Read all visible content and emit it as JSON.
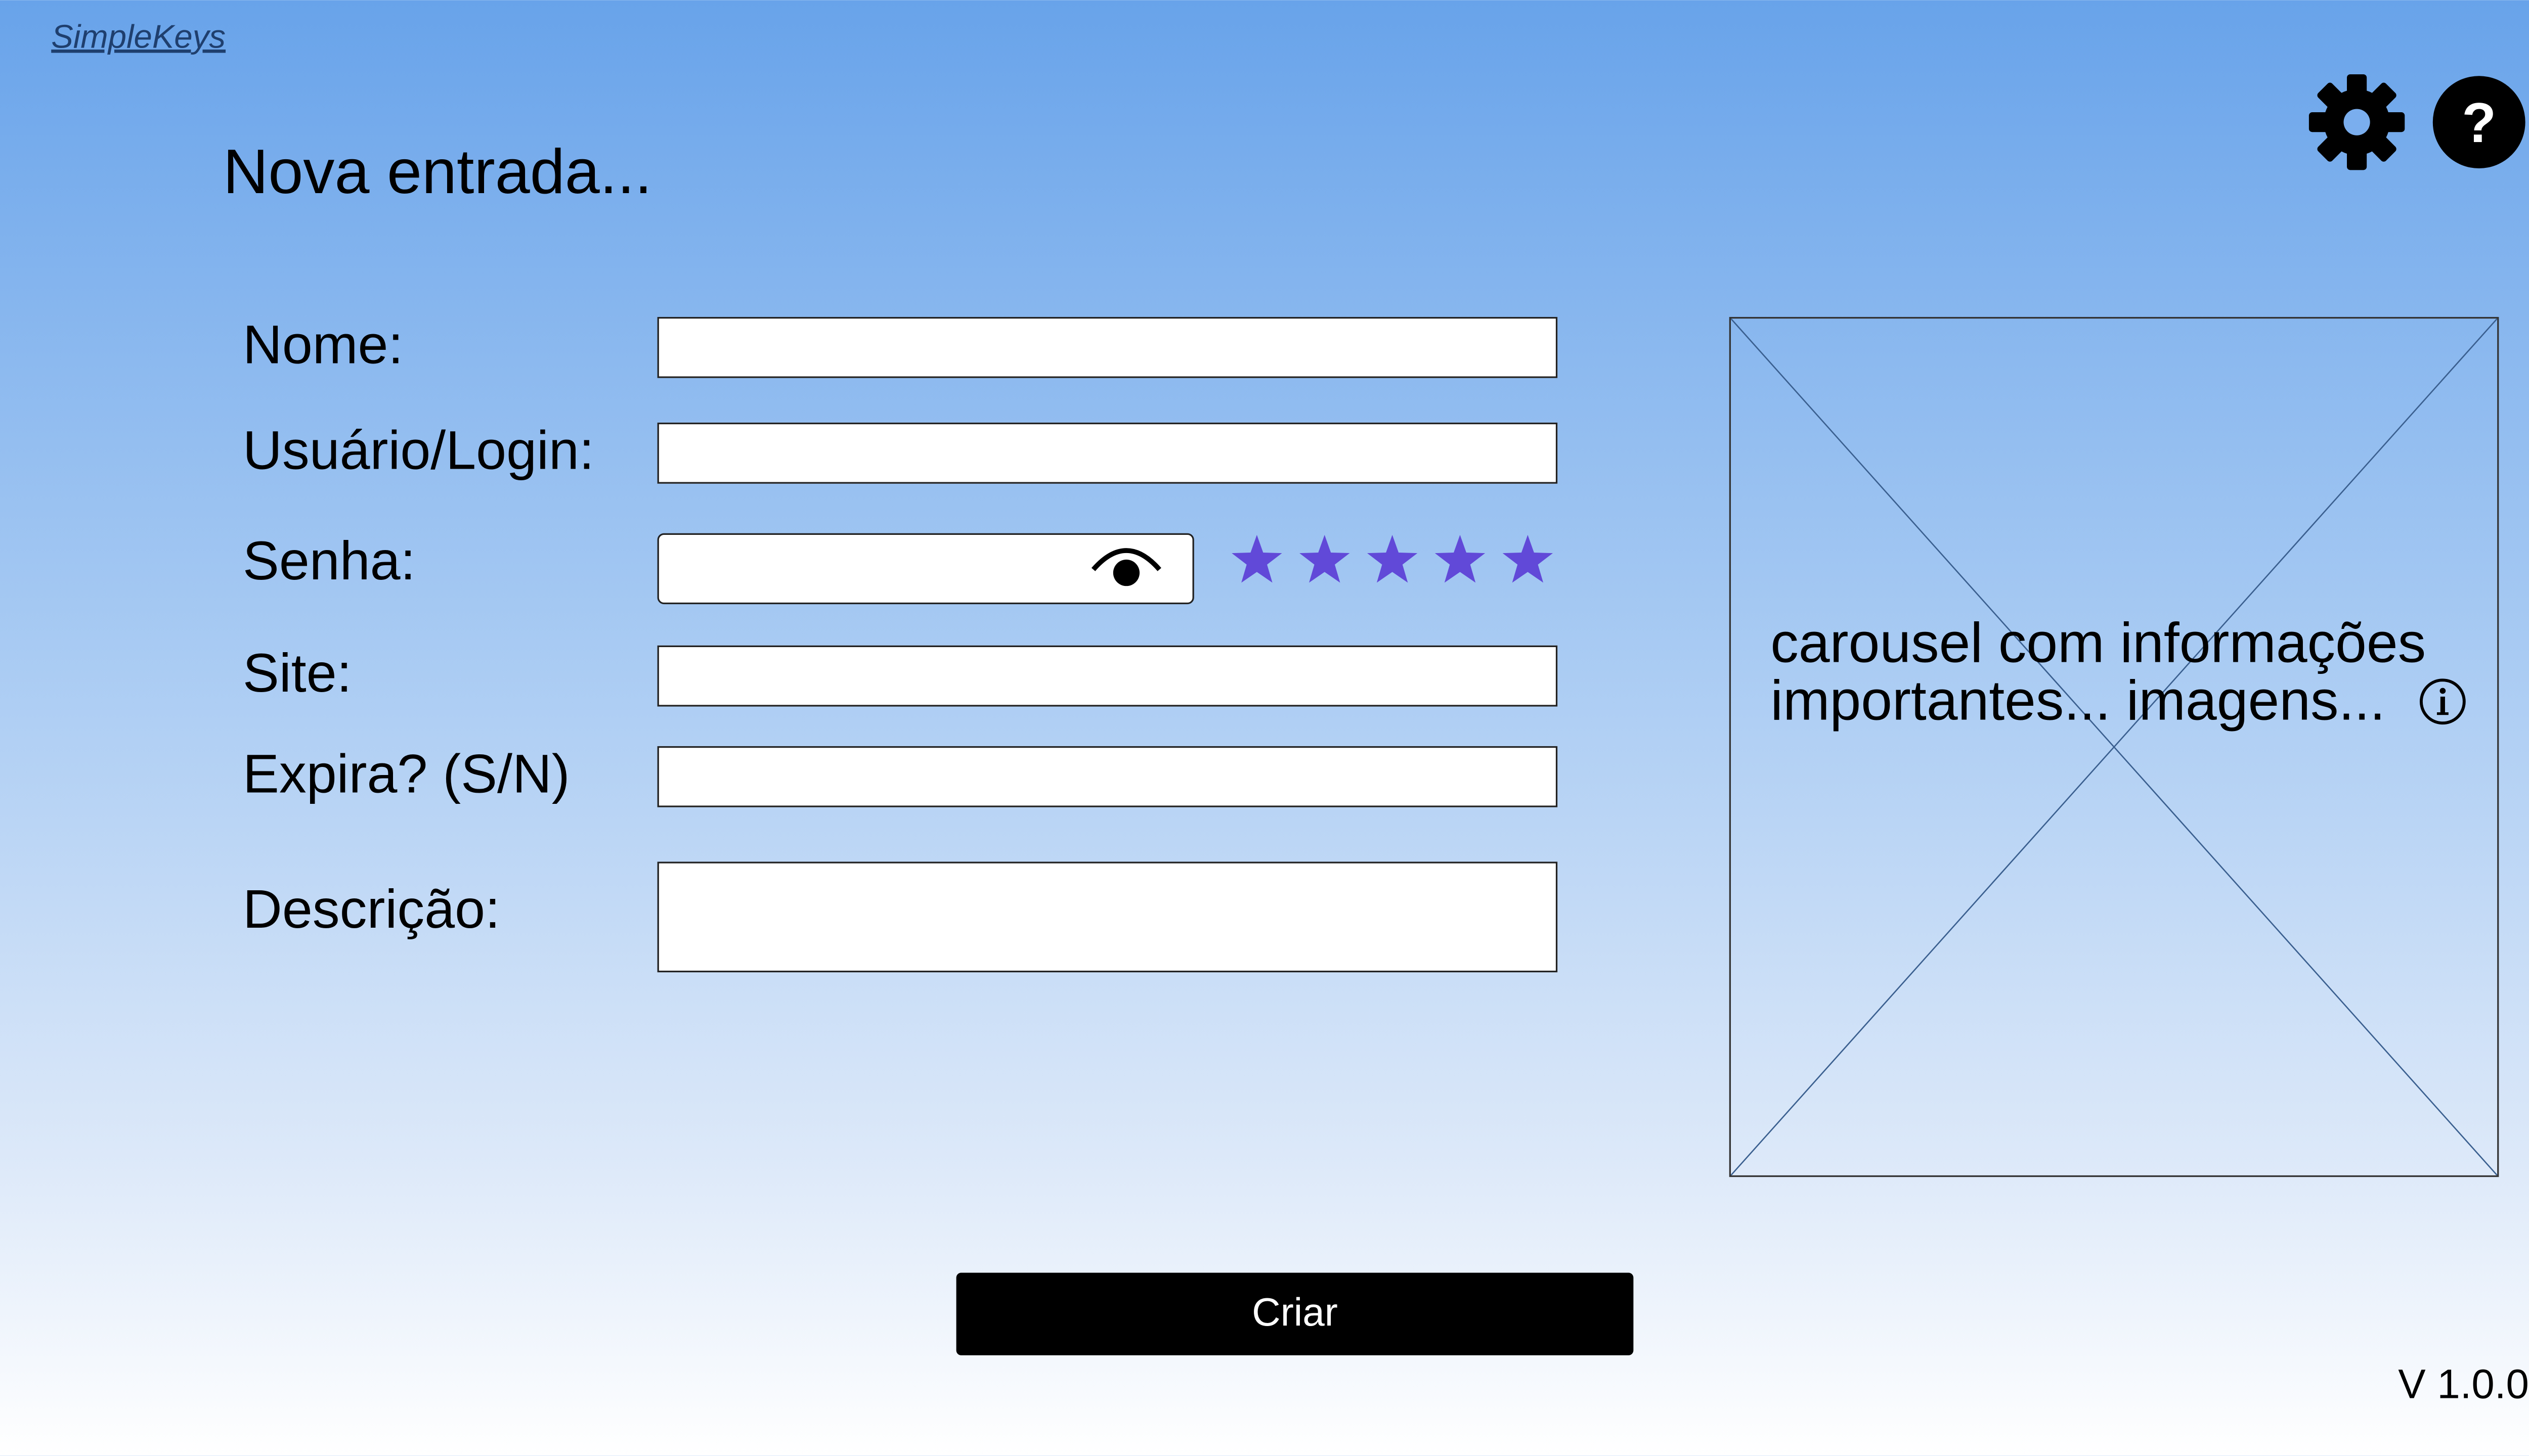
{
  "app": {
    "brand": "SimpleKeys",
    "version": "V 1.0.0"
  },
  "form": {
    "title": "Nova entrada...",
    "fields": {
      "nome": {
        "label": "Nome:",
        "value": ""
      },
      "usuario": {
        "label": "Usuário/Login:",
        "value": ""
      },
      "senha": {
        "label": "Senha:",
        "value": ""
      },
      "site": {
        "label": "Site:",
        "value": ""
      },
      "expira": {
        "label": "Expira? (S/N)",
        "value": ""
      },
      "descricao": {
        "label": "Descrição:",
        "value": ""
      }
    },
    "password_strength": {
      "filled": 5,
      "max": 5,
      "color": "#6149d8"
    },
    "submit_label": "Criar"
  },
  "carousel": {
    "text": "carousel com informações importantes... imagens..."
  },
  "icons": {
    "settings": "gear-icon",
    "help": "help-icon",
    "info": "info-icon",
    "visibility": "eye-icon",
    "strength": "star-icon"
  }
}
